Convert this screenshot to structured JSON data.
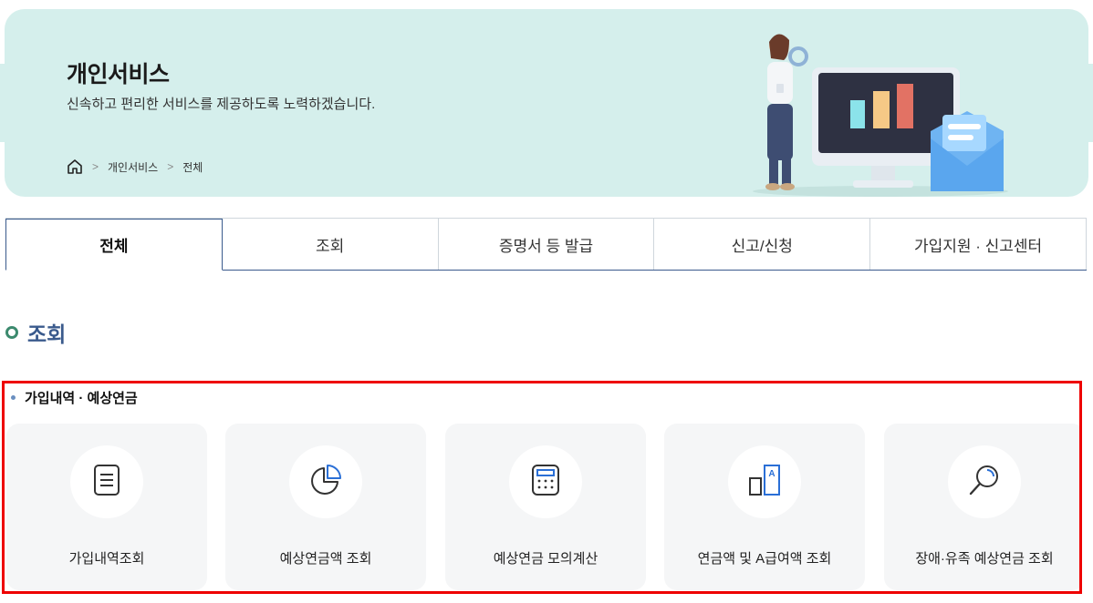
{
  "hero": {
    "title": "개인서비스",
    "subtitle": "신속하고 편리한 서비스를 제공하도록 노력하겠습니다.",
    "breadcrumb": [
      "개인서비스",
      "전체"
    ]
  },
  "tabs": [
    {
      "label": "전체",
      "active": true
    },
    {
      "label": "조회",
      "active": false
    },
    {
      "label": "증명서 등 발급",
      "active": false
    },
    {
      "label": "신고/신청",
      "active": false
    },
    {
      "label": "가입지원 · 신고센터",
      "active": false
    }
  ],
  "section": {
    "title": "조회",
    "group_label": "가입내역 · 예상연금",
    "cards": [
      {
        "label": "가입내역조회",
        "icon": "document-icon"
      },
      {
        "label": "예상연금액 조회",
        "icon": "pie-chart-icon"
      },
      {
        "label": "예상연금 모의계산",
        "icon": "calculator-icon"
      },
      {
        "label": "연금액 및 A급여액 조회",
        "icon": "a-benefit-icon"
      },
      {
        "label": "장애·유족 예상연금 조회",
        "icon": "magnifier-icon"
      }
    ]
  },
  "colors": {
    "hero_bg": "#d5efec",
    "accent": "#3a5a8c",
    "highlight_border": "#ee0000",
    "card_bg": "#f5f6f7"
  }
}
